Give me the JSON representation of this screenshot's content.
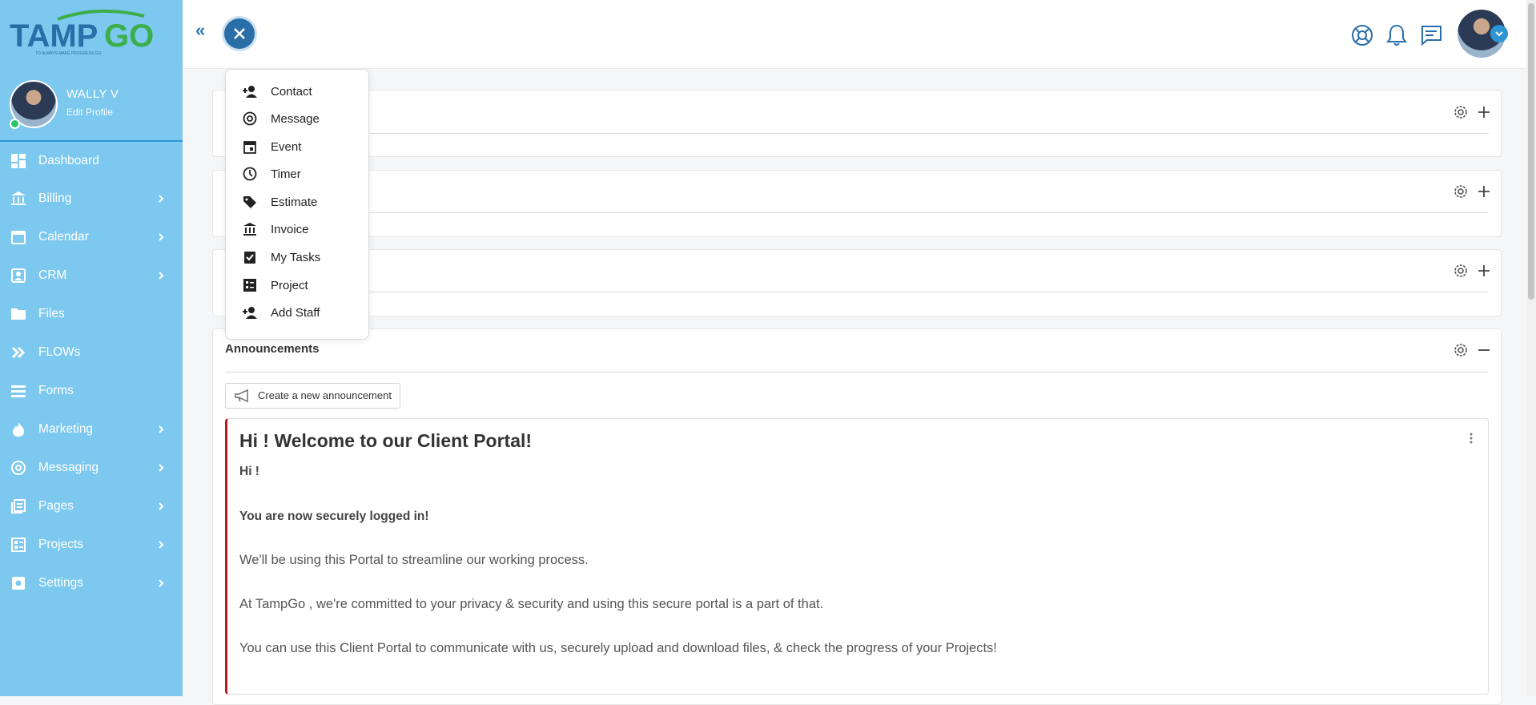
{
  "brand": {
    "name": "TAMPGO",
    "tagline": "TO ALWAYS MAKE PROGRESS GO",
    "primary": "#2a6ea8",
    "green": "#3cae4a",
    "sidebar_bg": "#7cc8ee"
  },
  "profile": {
    "name": "WALLY V",
    "edit_label": "Edit Profile"
  },
  "nav": [
    {
      "label": "Dashboard",
      "icon": "dashboard-icon",
      "chevron": false
    },
    {
      "label": "Billing",
      "icon": "bank-icon",
      "chevron": true
    },
    {
      "label": "Calendar",
      "icon": "calendar-icon",
      "chevron": true
    },
    {
      "label": "CRM",
      "icon": "contact-card-icon",
      "chevron": true
    },
    {
      "label": "Files",
      "icon": "folder-icon",
      "chevron": false
    },
    {
      "label": "FLOWs",
      "icon": "double-chevron-icon",
      "chevron": false
    },
    {
      "label": "Forms",
      "icon": "list-icon",
      "chevron": false
    },
    {
      "label": "Marketing",
      "icon": "flame-icon",
      "chevron": true
    },
    {
      "label": "Messaging",
      "icon": "at-icon",
      "chevron": true
    },
    {
      "label": "Pages",
      "icon": "pages-icon",
      "chevron": true
    },
    {
      "label": "Projects",
      "icon": "project-icon",
      "chevron": true
    },
    {
      "label": "Settings",
      "icon": "gear-icon",
      "chevron": true
    }
  ],
  "quick_add_menu": [
    {
      "label": "Contact",
      "icon": "person-add-icon"
    },
    {
      "label": "Message",
      "icon": "at-icon"
    },
    {
      "label": "Event",
      "icon": "calendar-event-icon"
    },
    {
      "label": "Timer",
      "icon": "timer-icon"
    },
    {
      "label": "Estimate",
      "icon": "tag-icon"
    },
    {
      "label": "Invoice",
      "icon": "bank-icon"
    },
    {
      "label": "My Tasks",
      "icon": "task-check-icon"
    },
    {
      "label": "Project",
      "icon": "project-icon"
    },
    {
      "label": "Add Staff",
      "icon": "person-add-icon"
    }
  ],
  "announcements": {
    "title": "Announcements",
    "create_button": "Create a new announcement",
    "post": {
      "title": "Hi ! Welcome to our Client Portal!",
      "greeting": "Hi !",
      "secure_line": "You are now securely logged in!",
      "p1": "We'll be using this Portal to streamline our working process.",
      "p2": "At TampGo , we're committed to your privacy & security and using this secure portal is a part of that.",
      "p3": "You can use this Client Portal to communicate with us, securely upload and download files, & check the progress of your Projects!"
    }
  }
}
